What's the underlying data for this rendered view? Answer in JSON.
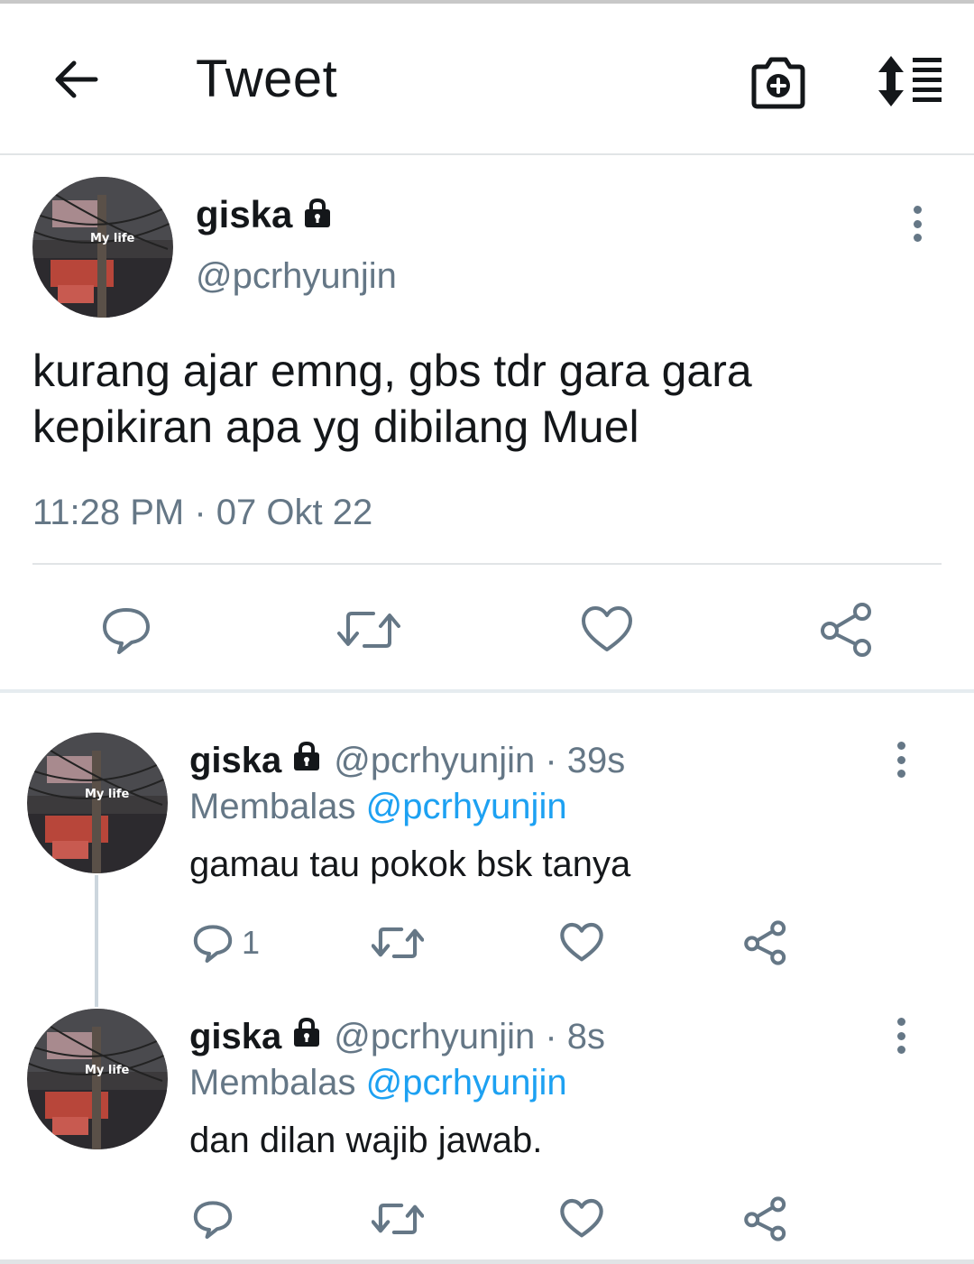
{
  "header": {
    "title": "Tweet",
    "icons": [
      "back-arrow-icon",
      "camera-add-icon",
      "sort-icon"
    ]
  },
  "main_tweet": {
    "avatar_label": "My life",
    "name": "giska",
    "handle": "@pcrhyunjin",
    "text_line1": "kurang ajar emng, gbs tdr gara gara",
    "text_line2": "kepikiran apa yg dibilang Muel",
    "timestamp": "11:28 PM · 07 Okt 22"
  },
  "replies": [
    {
      "avatar_label": "My life",
      "name": "giska",
      "handle_time": "@pcrhyunjin · 39s",
      "replying_prefix": "Membalas",
      "replying_to": "@pcrhyunjin",
      "text": "gamau tau pokok bsk tanya",
      "reply_count": "1"
    },
    {
      "avatar_label": "My life",
      "name": "giska",
      "handle_time": "@pcrhyunjin · 8s",
      "replying_prefix": "Membalas",
      "replying_to": "@pcrhyunjin",
      "text": "dan dilan wajib jawab.",
      "reply_count": ""
    }
  ],
  "colors": {
    "text": "#14171a",
    "secondary": "#657786",
    "mention": "#1da1f2",
    "divider": "#e1e4e6"
  }
}
